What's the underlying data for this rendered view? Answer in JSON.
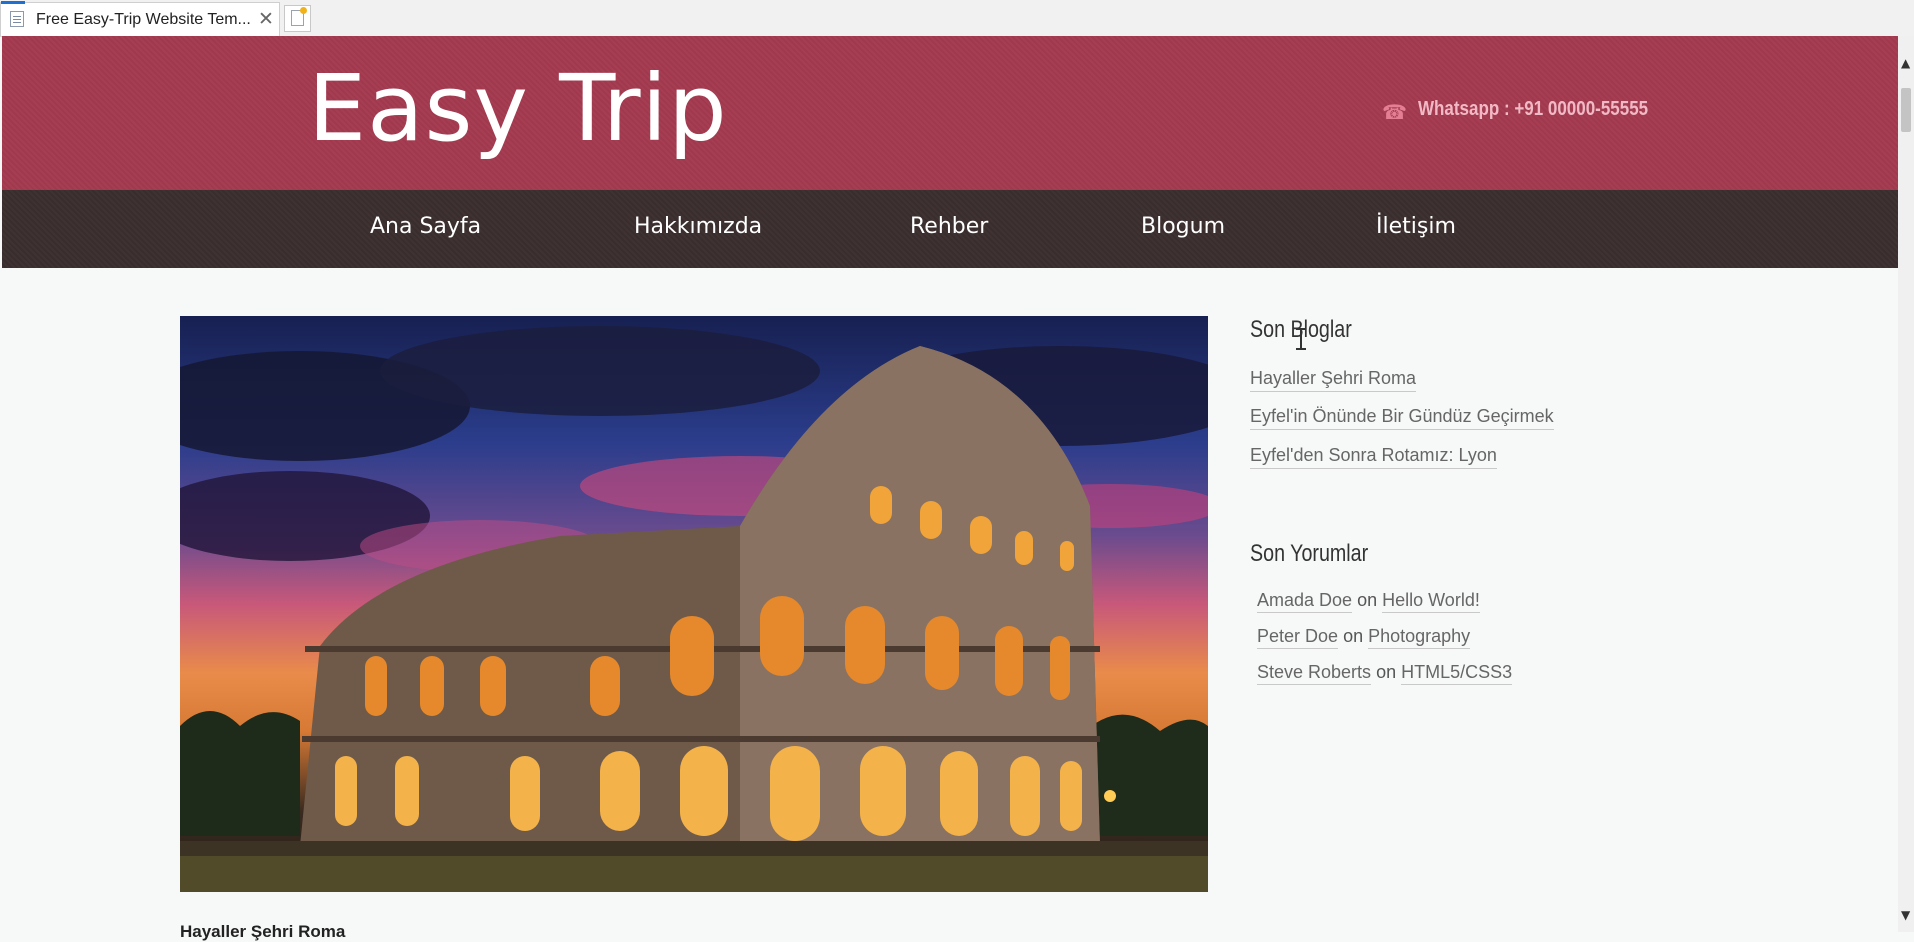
{
  "browser": {
    "tab_title": "Free Easy-Trip Website Tem...",
    "close_glyph": "✕",
    "icons": [
      "page-icon",
      "close-icon",
      "new-tab-icon"
    ]
  },
  "header": {
    "logo": "Easy Trip",
    "phone_icon": "☎",
    "contact": "Whatsapp : +91 00000-55555",
    "colors": {
      "header_bg": "#a3394f",
      "nav_bg": "#3b2e2e"
    }
  },
  "nav": {
    "items": [
      "Ana Sayfa",
      "Hakkımızda",
      "Rehber",
      "Blogum",
      "İletişim"
    ]
  },
  "sidebar": {
    "recent_blogs": {
      "heading": "Son Bloglar",
      "items": [
        "Hayaller Şehri Roma",
        "Eyfel'in Önünde Bir Gündüz Geçirmek",
        "Eyfel'den Sonra Rotamız: Lyon"
      ]
    },
    "recent_comments": {
      "heading": "Son Yorumlar",
      "items": [
        {
          "author": "Amada Doe",
          "on": "on",
          "post": "Hello World!"
        },
        {
          "author": "Peter Doe",
          "on": "on",
          "post": "Photography"
        },
        {
          "author": "Steve Roberts",
          "on": "on",
          "post": "HTML5/CSS3"
        }
      ]
    }
  },
  "main": {
    "post_title": "Hayaller Şehri Roma"
  },
  "scrollbar": {
    "up": "▲",
    "down": "▼"
  }
}
